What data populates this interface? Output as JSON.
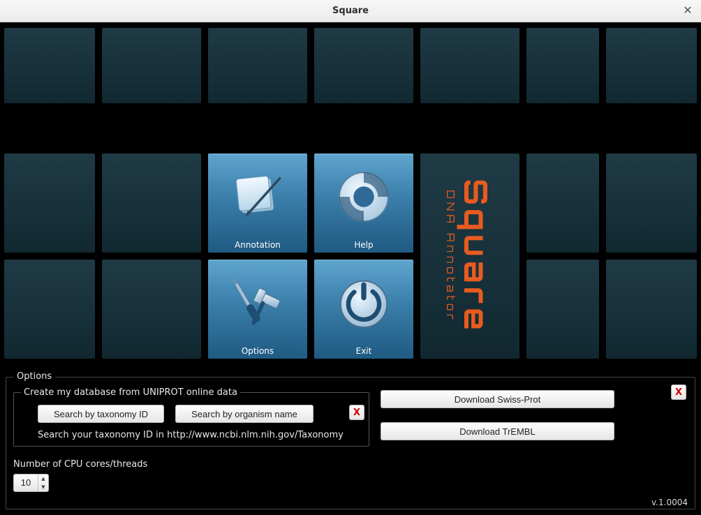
{
  "titlebar": {
    "title": "Square"
  },
  "main_buttons": {
    "annotation": "Annotation",
    "help": "Help",
    "options": "Options",
    "exit": "Exit"
  },
  "logo": {
    "line1": "Square",
    "line2": "DNA Annotator"
  },
  "options": {
    "legend": "Options",
    "db_legend": "Create my database from UNIPROT online data",
    "search_tax_button": "Search by taxonomy ID",
    "search_org_button": "Search by organism name",
    "hint": "Search your taxonomy ID in http://www.ncbi.nlm.nih.gov/Taxonomy",
    "download_swissprot": "Download Swiss-Prot",
    "download_trembl": "Download TrEMBL",
    "close_label": "X",
    "threads_label": "Number of CPU cores/threads",
    "threads_value": "10",
    "version": "v.1.0004"
  }
}
